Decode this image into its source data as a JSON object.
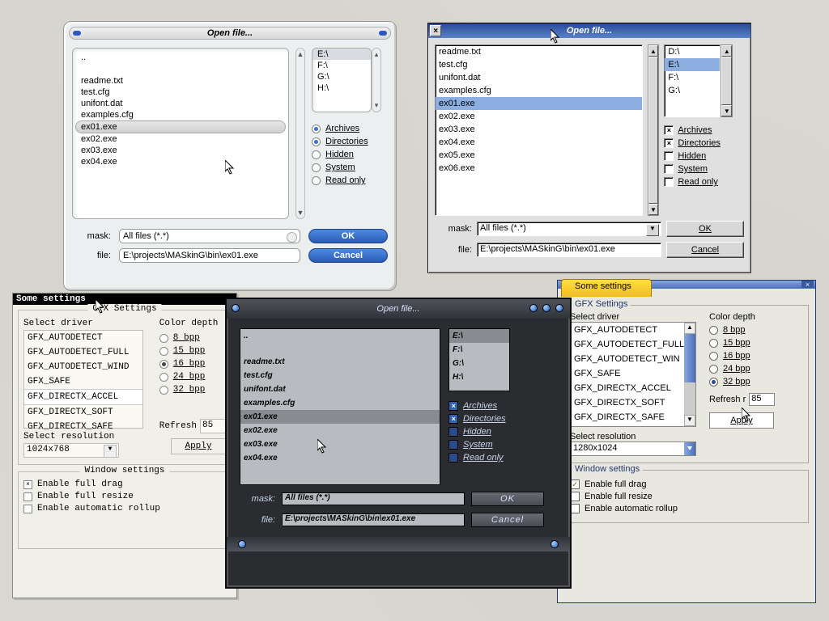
{
  "openA": {
    "title": "Open file...",
    "files": [
      "..",
      "readme.txt",
      "test.cfg",
      "unifont.dat",
      "examples.cfg",
      "ex01.exe",
      "ex02.exe",
      "ex03.exe",
      "ex04.exe"
    ],
    "selected_file": "ex01.exe",
    "drives": [
      "E:\\",
      "F:\\",
      "G:\\",
      "H:\\"
    ],
    "selected_drive": "E:\\",
    "filters": {
      "archives": "Archives",
      "directories": "Directories",
      "hidden": "Hidden",
      "system": "System",
      "readonly": "Read only"
    },
    "filter_state": {
      "archives": true,
      "directories": true,
      "hidden": false,
      "system": false,
      "readonly": false
    },
    "mask_label": "mask:",
    "mask_value": "All files (*.*)",
    "file_label": "file:",
    "file_value": "E:\\projects\\MASkinG\\bin\\ex01.exe",
    "ok": "OK",
    "cancel": "Cancel"
  },
  "openB": {
    "title": "Open file...",
    "files": [
      "readme.txt",
      "test.cfg",
      "unifont.dat",
      "examples.cfg",
      "ex01.exe",
      "ex02.exe",
      "ex03.exe",
      "ex04.exe",
      "ex05.exe",
      "ex06.exe"
    ],
    "selected_file": "ex01.exe",
    "drives": [
      "D:\\",
      "E:\\",
      "F:\\",
      "G:\\"
    ],
    "selected_drive": "E:\\",
    "filters": {
      "archives": "Archives",
      "directories": "Directories",
      "hidden": "Hidden",
      "system": "System",
      "readonly": "Read only"
    },
    "filter_state": {
      "archives": true,
      "directories": true,
      "hidden": false,
      "system": false,
      "readonly": false
    },
    "mask_label": "mask:",
    "mask_value": "All files (*.*)",
    "file_label": "file:",
    "file_value": "E:\\projects\\MASkinG\\bin\\ex01.exe",
    "ok": "OK",
    "cancel": "Cancel"
  },
  "openE": {
    "title": "Open file...",
    "files": [
      "..",
      "readme.txt",
      "test.cfg",
      "unifont.dat",
      "examples.cfg",
      "ex01.exe",
      "ex02.exe",
      "ex03.exe",
      "ex04.exe"
    ],
    "selected_file": "ex01.exe",
    "drives": [
      "E:\\",
      "F:\\",
      "G:\\",
      "H:\\"
    ],
    "selected_drive": "E:\\",
    "filters": {
      "archives": "Archives",
      "directories": "Directories",
      "hidden": "Hidden",
      "system": "System",
      "readonly": "Read only"
    },
    "filter_state": {
      "archives": true,
      "directories": true,
      "hidden": false,
      "system": false,
      "readonly": false
    },
    "mask_label": "mask:",
    "mask_value": "All files (*.*)",
    "file_label": "file:",
    "file_value": "E:\\projects\\MASkinG\\bin\\ex01.exe",
    "ok": "OK",
    "cancel": "Cancel"
  },
  "setC": {
    "title": "Some settings",
    "gfx_legend": "GFX Settings",
    "win_legend": "Window settings",
    "driver_label": "Select driver",
    "drivers": [
      "GFX_AUTODETECT",
      "GFX_AUTODETECT_FULL",
      "GFX_AUTODETECT_WIND",
      "GFX_SAFE",
      "GFX_DIRECTX_ACCEL",
      "GFX_DIRECTX_SOFT",
      "GFX_DIRECTX_SAFE"
    ],
    "selected_driver": "GFX_DIRECTX_ACCEL",
    "depth_label": "Color depth",
    "depths": [
      "8 bpp",
      "15 bpp",
      "16 bpp",
      "24 bpp",
      "32 bpp"
    ],
    "selected_depth": "16 bpp",
    "res_label": "Select resolution",
    "resolution": "1024x768",
    "refresh_label": "Refresh",
    "refresh_value": "85",
    "apply": "Apply",
    "full_drag": "Enable full drag",
    "full_resize": "Enable full resize",
    "auto_rollup": "Enable automatic rollup",
    "win_state": {
      "full_drag": true,
      "full_resize": false,
      "auto_rollup": false
    }
  },
  "setD": {
    "title": "Some settings",
    "gfx_legend": "GFX Settings",
    "win_legend": "Window settings",
    "driver_label": "Select driver",
    "drivers": [
      "GFX_AUTODETECT",
      "GFX_AUTODETECT_FULL",
      "GFX_AUTODETECT_WIN",
      "GFX_SAFE",
      "GFX_DIRECTX_ACCEL",
      "GFX_DIRECTX_SOFT",
      "GFX_DIRECTX_SAFE"
    ],
    "depth_label": "Color depth",
    "depths": [
      "8 bpp",
      "15 bpp",
      "16 bpp",
      "24 bpp",
      "32 bpp"
    ],
    "selected_depth": "32 bpp",
    "res_label": "Select resolution",
    "resolution": "1280x1024",
    "refresh_label": "Refresh r",
    "refresh_value": "85",
    "apply": "Apply",
    "full_drag": "Enable full drag",
    "full_resize": "Enable full resize",
    "auto_rollup": "Enable automatic rollup",
    "win_state": {
      "full_drag": true,
      "full_resize": false,
      "auto_rollup": false
    }
  }
}
